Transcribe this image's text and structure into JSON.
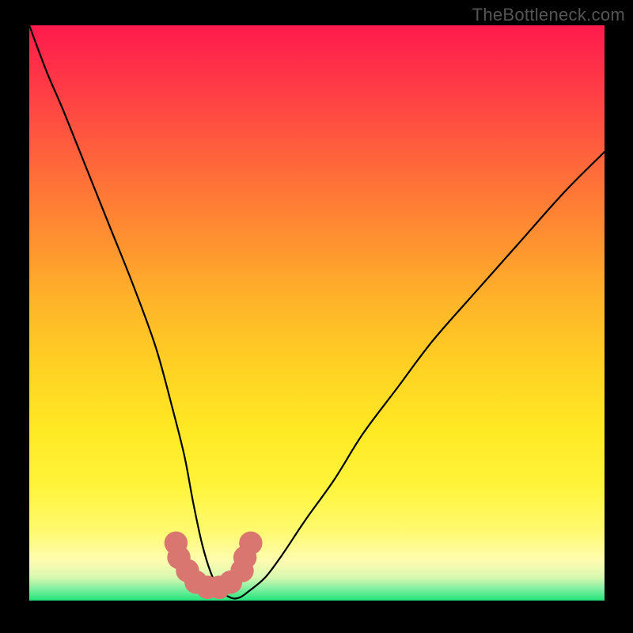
{
  "watermark": "TheBottleneck.com",
  "chart_data": {
    "type": "line",
    "title": "",
    "xlabel": "",
    "ylabel": "",
    "xlim": [
      0,
      100
    ],
    "ylim": [
      0,
      100
    ],
    "series": [
      {
        "name": "curve",
        "x": [
          0,
          3,
          6,
          10,
          14,
          18,
          22,
          25,
          27,
          28.5,
          30,
          31.5,
          33,
          35,
          36.5,
          38,
          41,
          44,
          48,
          53,
          58,
          64,
          70,
          77,
          85,
          93,
          100
        ],
        "y": [
          100,
          92,
          85,
          75,
          65,
          55,
          44,
          33,
          25,
          17,
          10,
          5,
          2,
          0.5,
          0.5,
          1.5,
          4,
          8,
          14,
          21,
          29,
          37,
          45,
          53,
          62,
          71,
          78
        ]
      }
    ],
    "markers": [
      {
        "name": "dot-left-upper",
        "x": 25.5,
        "y": 10.0,
        "r": 1.2,
        "color": "#d8766f"
      },
      {
        "name": "dot-left-lower",
        "x": 26.0,
        "y": 7.5,
        "r": 1.2,
        "color": "#d8766f"
      },
      {
        "name": "dot-left-joint",
        "x": 27.5,
        "y": 5.2,
        "r": 1.2,
        "color": "#d8766f"
      },
      {
        "name": "dot-right-upper",
        "x": 38.5,
        "y": 10.0,
        "r": 1.2,
        "color": "#d8766f"
      },
      {
        "name": "dot-right-lower",
        "x": 37.5,
        "y": 7.5,
        "r": 1.2,
        "color": "#d8766f"
      },
      {
        "name": "dot-right-joint",
        "x": 37.0,
        "y": 5.2,
        "r": 1.2,
        "color": "#d8766f"
      },
      {
        "name": "dot-valley-1",
        "x": 29.0,
        "y": 3.2,
        "r": 1.2,
        "color": "#d8766f"
      },
      {
        "name": "dot-valley-2",
        "x": 31.0,
        "y": 2.3,
        "r": 1.2,
        "color": "#d8766f"
      },
      {
        "name": "dot-valley-3",
        "x": 33.0,
        "y": 2.3,
        "r": 1.2,
        "color": "#d8766f"
      },
      {
        "name": "dot-valley-4",
        "x": 35.0,
        "y": 3.2,
        "r": 1.2,
        "color": "#d8766f"
      }
    ],
    "axes_visible": false,
    "grid": false,
    "legend": false
  }
}
